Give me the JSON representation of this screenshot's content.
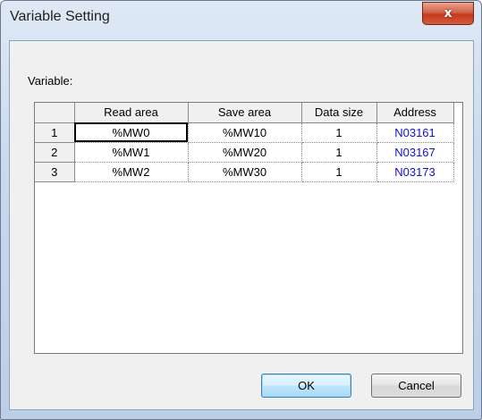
{
  "window": {
    "title": "Variable Setting",
    "close_glyph": "x"
  },
  "variable_label": "Variable:",
  "grid": {
    "columns": [
      "",
      "Read area",
      "Save area",
      "Data size",
      "Address"
    ],
    "rows": [
      {
        "num": "1",
        "read": "%MW0",
        "save": "%MW10",
        "size": "1",
        "address": "N03161"
      },
      {
        "num": "2",
        "read": "%MW1",
        "save": "%MW20",
        "size": "1",
        "address": "N03167"
      },
      {
        "num": "3",
        "read": "%MW2",
        "save": "%MW30",
        "size": "1",
        "address": "N03173"
      }
    ],
    "address_color": "#1010d0"
  },
  "buttons": {
    "ok": "OK",
    "cancel": "Cancel"
  }
}
